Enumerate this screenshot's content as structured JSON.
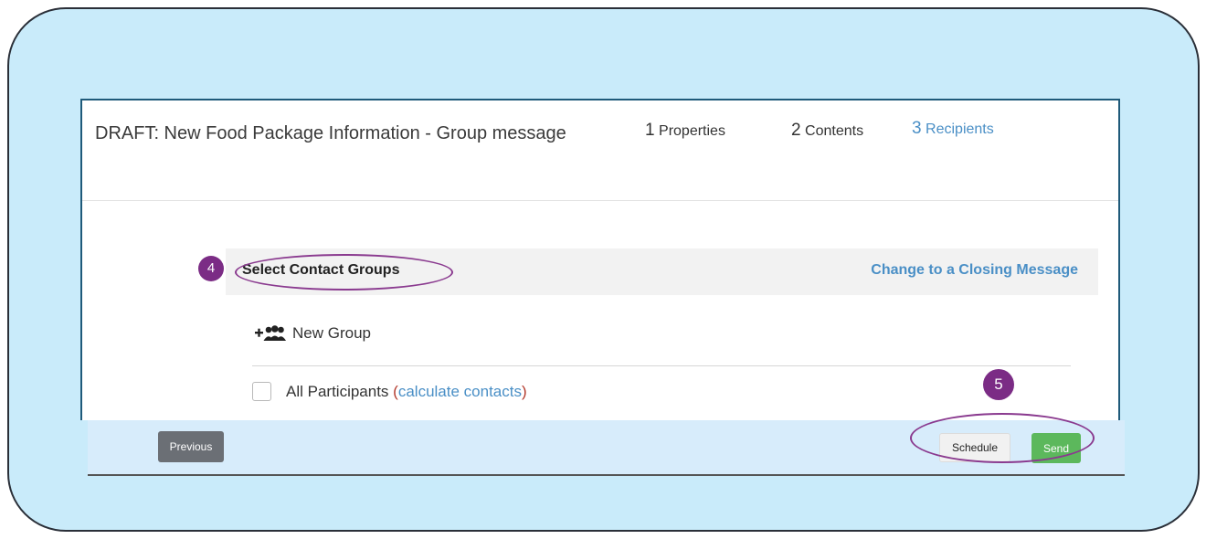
{
  "message": {
    "title": "DRAFT: New Food Package Information - Group message"
  },
  "steps": [
    {
      "num": "1",
      "label": "Properties"
    },
    {
      "num": "2",
      "label": "Contents"
    },
    {
      "num": "3",
      "label": "Recipients"
    }
  ],
  "section": {
    "title": "Select Contact Groups",
    "closing_link": "Change to a Closing Message"
  },
  "new_group": {
    "icon": "user-plus-icon",
    "label": "New Group"
  },
  "all_participants": {
    "label": "All Participants",
    "open_paren": "(",
    "link": "calculate contacts",
    "close_paren": ")",
    "checked": false
  },
  "footer": {
    "previous_label": "Previous",
    "schedule_label": "Schedule",
    "send_label": "Send"
  },
  "annotations": {
    "badge_4": "4",
    "badge_5": "5"
  },
  "colors": {
    "frame_bg": "#c9ebfa",
    "accent_link": "#4a8fc6",
    "send_green": "#5cb85c",
    "annotation_purple": "#7b2c85"
  }
}
